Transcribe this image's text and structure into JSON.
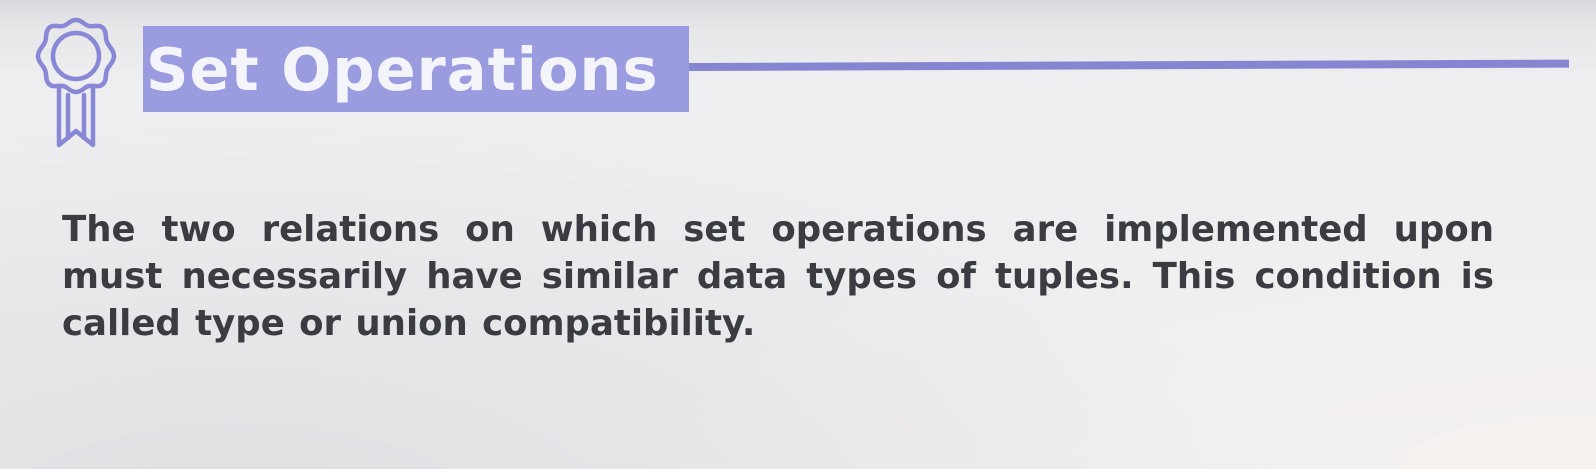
{
  "slide": {
    "title": "Set Operations",
    "body": "The two relations on which set operations are implemented upon must necessarily have similar data types of tuples. This condition is called type or union compatibility.",
    "icon": "award-ribbon-icon",
    "colors": {
      "title_box": "#9b9be0",
      "title_text": "#f4f4fb",
      "rule": "#8585d2",
      "icon_stroke": "#8888d6",
      "body_text": "#3b3b42",
      "background": "#eeeef0"
    }
  }
}
